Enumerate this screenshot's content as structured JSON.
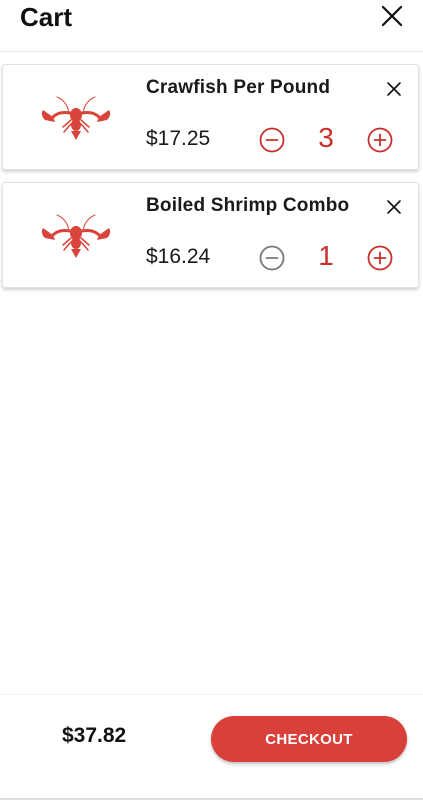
{
  "header": {
    "title": "Cart",
    "close_icon": "close-icon"
  },
  "cart_items": [
    {
      "name": "Crawfish Per Pound",
      "price": "$17.25",
      "quantity": "3",
      "image_icon": "crawfish-icon",
      "minus_enabled": true
    },
    {
      "name": "Boiled Shrimp Combo",
      "price": "$16.24",
      "quantity": "1",
      "image_icon": "crawfish-icon",
      "minus_enabled": false
    }
  ],
  "footer": {
    "total": "$37.82",
    "checkout_label": "CHECKOUT"
  },
  "colors": {
    "accent": "#d9403a",
    "quantity_text": "#c9302c",
    "disabled_icon": "#777777",
    "crawfish": "#d9443a"
  }
}
